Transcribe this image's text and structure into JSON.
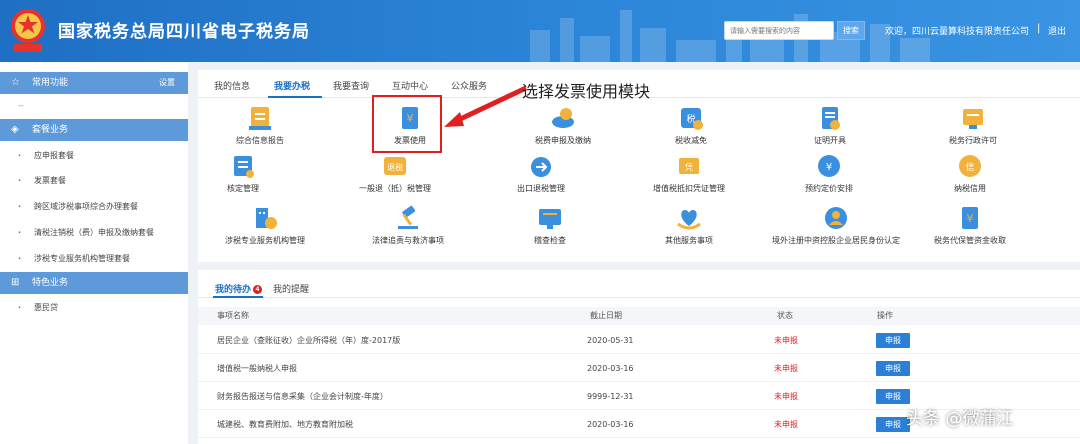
{
  "header": {
    "title": "国家税务总局四川省电子税务局",
    "search_placeholder": "请输入需要搜索的内容",
    "search_button": "搜索",
    "welcome": "欢迎，四川云量算科技有限责任公司",
    "separator": "|",
    "logout": "退出"
  },
  "sidebar": {
    "sections": [
      {
        "label": "常用功能",
        "icon": "star-icon",
        "setting": "设置"
      },
      {
        "label": "套餐业务",
        "icon": "layers-icon"
      },
      {
        "label": "特色业务",
        "icon": "grid-icon"
      }
    ],
    "common_empty": "--",
    "package_items": [
      "应申报套餐",
      "发票套餐",
      "跨区域涉税事项综合办理套餐",
      "清税注销税（费）申报及缴纳套餐",
      "涉税专业服务机构管理套餐"
    ],
    "special_items": [
      "惠民贷"
    ]
  },
  "tabs": [
    "我的信息",
    "我要办税",
    "我要查询",
    "互动中心",
    "公众服务"
  ],
  "annotation": "选择发票使用模块",
  "functions": [
    {
      "label": "综合信息报告",
      "icon": "report-icon"
    },
    {
      "label": "发票使用",
      "icon": "invoice-icon"
    },
    {
      "label": "税费申报及缴纳",
      "icon": "tax-payment-icon"
    },
    {
      "label": "税收减免",
      "icon": "tax-relief-icon"
    },
    {
      "label": "证明开具",
      "icon": "certificate-icon"
    },
    {
      "label": "税务行政许可",
      "icon": "license-icon"
    },
    {
      "label": "核定管理",
      "icon": "verify-icon"
    },
    {
      "label": "一般退（抵）税管理",
      "icon": "refund-icon"
    },
    {
      "label": "出口退税管理",
      "icon": "export-refund-icon"
    },
    {
      "label": "增值税抵扣凭证管理",
      "icon": "vat-voucher-icon"
    },
    {
      "label": "预约定价安排",
      "icon": "pricing-icon"
    },
    {
      "label": "纳税信用",
      "icon": "credit-icon"
    },
    {
      "label": "涉税专业服务机构管理",
      "icon": "agency-icon"
    },
    {
      "label": "法律追责与救济事项",
      "icon": "gavel-icon"
    },
    {
      "label": "稽查检查",
      "icon": "inspection-icon"
    },
    {
      "label": "其他服务事项",
      "icon": "service-icon"
    },
    {
      "label": "境外注册中资控股企业居民身份认定",
      "icon": "resident-icon"
    },
    {
      "label": "税务代保管资金收取",
      "icon": "custody-fund-icon"
    }
  ],
  "todo": {
    "tabs": [
      "我的待办",
      "我的提醒"
    ],
    "badge": "4",
    "columns": [
      "事项名称",
      "截止日期",
      "状态",
      "操作"
    ],
    "rows": [
      {
        "name": "居民企业（查账征收）企业所得税（年）度-2017版",
        "date": "2020-05-31",
        "status": "未申报",
        "action": "申报"
      },
      {
        "name": "增值税一般纳税人申报",
        "date": "2020-03-16",
        "status": "未申报",
        "action": "申报"
      },
      {
        "name": "财务报告报送与信息采集（企业会计制度-年度）",
        "date": "9999-12-31",
        "status": "未申报",
        "action": "申报"
      },
      {
        "name": "城建税、教育费附加、地方教育附加税",
        "date": "2020-03-16",
        "status": "未申报",
        "action": "申报"
      }
    ]
  },
  "watermark": "头条 @微蒲江",
  "colors": {
    "header": "#2c86d9",
    "sidebar_section": "#5e9ad9",
    "accent": "#1a6fc7",
    "alert": "#e02020"
  }
}
